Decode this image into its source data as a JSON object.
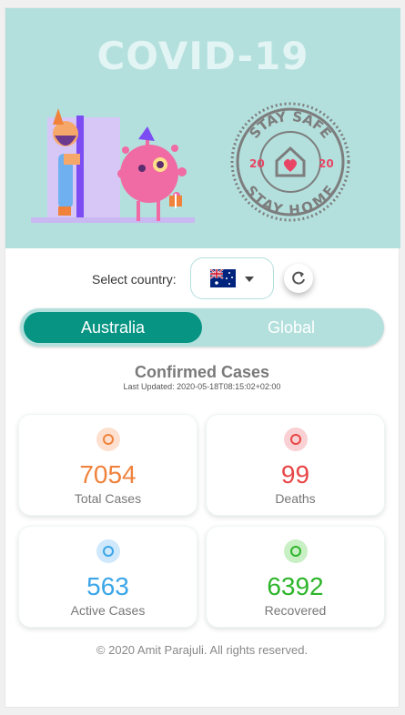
{
  "header": {
    "title": "COVID-19"
  },
  "stamp": {
    "top_text": "STAY SAFE",
    "bottom_text": "STAY HOME",
    "left_num": "20",
    "right_num": "20"
  },
  "selector": {
    "label": "Select country:",
    "selected_country": "Australia"
  },
  "toggle": {
    "option1": "Australia",
    "option2": "Global"
  },
  "section": {
    "title": "Confirmed Cases",
    "last_updated": "Last Updated: 2020-05-18T08:15:02+02:00"
  },
  "stats": [
    {
      "value": "7054",
      "label": "Total Cases",
      "color": "#f0823c",
      "icon_bg": "#fde0cf"
    },
    {
      "value": "99",
      "label": "Deaths",
      "color": "#e84545",
      "icon_bg": "#f9d0d3"
    },
    {
      "value": "563",
      "label": "Active Cases",
      "color": "#3aa6e8",
      "icon_bg": "#cfe8fb"
    },
    {
      "value": "6392",
      "label": "Recovered",
      "color": "#2db52a",
      "icon_bg": "#c9efc4"
    }
  ],
  "footer": {
    "text": "© 2020 Amit Parajuli. All rights reserved."
  },
  "colors": {
    "primary": "#079483",
    "hero_bg": "#b3e0dd"
  }
}
